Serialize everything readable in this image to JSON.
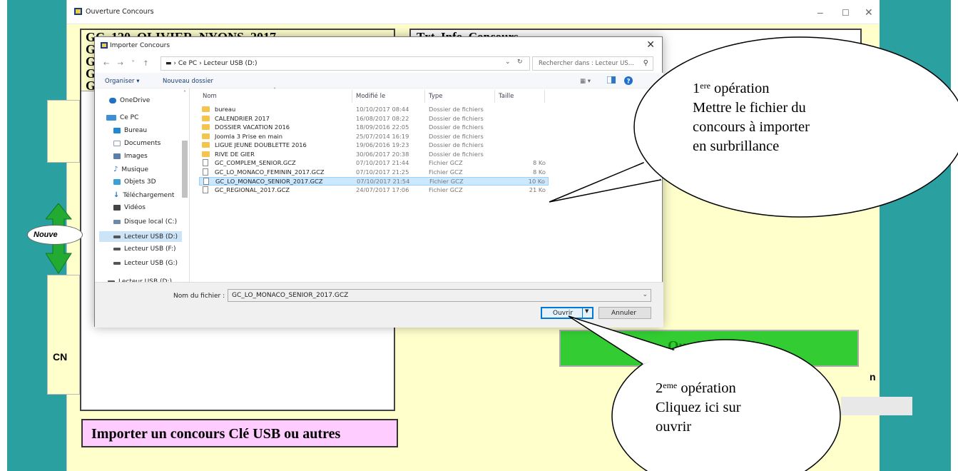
{
  "app_window": {
    "title": "Ouverture Concours",
    "header_text": "GC_120_OLIVIER_NYONS_2017",
    "header_partial_letters": [
      "G",
      "G",
      "G",
      "G"
    ],
    "right_header": "Txt_Info_Concours",
    "green_button_label": "Ouverture",
    "import_button_label": "Importer un concours Clé USB ou autres",
    "side_label_left": "CN",
    "side_label_right": "n",
    "nouveau_label": "Nouve"
  },
  "dialog": {
    "title": "Importer Concours",
    "breadcrumb": "▬  › Ce PC  ›  Lecteur USB (D:)",
    "search_placeholder": "Rechercher dans : Lecteur US...",
    "toolbar": {
      "organize": "Organiser ▾",
      "new_folder": "Nouveau dossier"
    },
    "nav_items": [
      {
        "label": "OneDrive",
        "icon": "cloud-icon",
        "color": "#1e70c8",
        "selected": false
      },
      {
        "label": "Ce PC",
        "icon": "computer-icon",
        "color": "#3d8fd6",
        "selected": false
      },
      {
        "label": "Bureau",
        "icon": "desktop-icon",
        "color": "#1e88d0",
        "selected": false
      },
      {
        "label": "Documents",
        "icon": "document-icon",
        "color": "#8aa0b8",
        "selected": false
      },
      {
        "label": "Images",
        "icon": "images-icon",
        "color": "#5a7fa8",
        "selected": false
      },
      {
        "label": "Musique",
        "icon": "music-icon",
        "color": "#2a6fb8",
        "selected": false
      },
      {
        "label": "Objets 3D",
        "icon": "cube-icon",
        "color": "#3aa0d8",
        "selected": false
      },
      {
        "label": "Téléchargement",
        "icon": "download-icon",
        "color": "#1f6fc0",
        "selected": false
      },
      {
        "label": "Vidéos",
        "icon": "video-icon",
        "color": "#444",
        "selected": false
      },
      {
        "label": "Disque local (C:)",
        "icon": "disk-icon",
        "color": "#6a8aa8",
        "selected": false
      },
      {
        "label": "Lecteur USB (D:)",
        "icon": "usb-drive-icon",
        "color": "#555",
        "selected": true
      },
      {
        "label": "Lecteur USB (F:)",
        "icon": "usb-drive-icon",
        "color": "#555",
        "selected": false
      },
      {
        "label": "Lecteur USB (G:)",
        "icon": "usb-drive-icon",
        "color": "#555",
        "selected": false
      },
      {
        "label": "Lecteur USB (D:)",
        "icon": "usb-drive-icon",
        "color": "#555",
        "selected": false
      }
    ],
    "columns": {
      "name": "Nom",
      "modified": "Modifié le",
      "type": "Type",
      "size": "Taille"
    },
    "files": [
      {
        "name": "bureau",
        "modified": "10/10/2017 08:44",
        "type": "Dossier de fichiers",
        "size": "",
        "kind": "folder",
        "selected": false
      },
      {
        "name": "CALENDRIER 2017",
        "modified": "16/08/2017 08:22",
        "type": "Dossier de fichiers",
        "size": "",
        "kind": "folder",
        "selected": false
      },
      {
        "name": "DOSSIER VACATION 2016",
        "modified": "18/09/2016 22:05",
        "type": "Dossier de fichiers",
        "size": "",
        "kind": "folder",
        "selected": false
      },
      {
        "name": "Joomla 3 Prise en main",
        "modified": "25/07/2014 16:19",
        "type": "Dossier de fichiers",
        "size": "",
        "kind": "folder",
        "selected": false
      },
      {
        "name": "LIGUE JEUNE DOUBLETTE 2016",
        "modified": "19/06/2016 19:23",
        "type": "Dossier de fichiers",
        "size": "",
        "kind": "folder",
        "selected": false
      },
      {
        "name": "RIVE DE GIER",
        "modified": "30/06/2017 20:38",
        "type": "Dossier de fichiers",
        "size": "",
        "kind": "folder",
        "selected": false
      },
      {
        "name": "GC_COMPLEM_SENIOR.GCZ",
        "modified": "07/10/2017 21:44",
        "type": "Fichier GCZ",
        "size": "8 Ko",
        "kind": "file",
        "selected": false
      },
      {
        "name": "GC_LO_MONACO_FEMININ_2017.GCZ",
        "modified": "07/10/2017 21:25",
        "type": "Fichier GCZ",
        "size": "8 Ko",
        "kind": "file",
        "selected": false
      },
      {
        "name": "GC_LO_MONACO_SENIOR_2017.GCZ",
        "modified": "07/10/2017 21:54",
        "type": "Fichier GCZ",
        "size": "10 Ko",
        "kind": "file",
        "selected": true
      },
      {
        "name": "GC_REGIONAL_2017.GCZ",
        "modified": "24/07/2017 17:06",
        "type": "Fichier GCZ",
        "size": "21 Ko",
        "kind": "file",
        "selected": false
      }
    ],
    "filename_label": "Nom du fichier :",
    "filename_value": "GC_LO_MONACO_SENIOR_2017.GCZ",
    "open_button": "Ouvrir",
    "cancel_button": "Annuler"
  },
  "callouts": {
    "first": {
      "ordinal": "1",
      "sup": "ere",
      "title": " opération",
      "lines": [
        "Mettre le fichier du",
        "concours à importer",
        "en surbrillance"
      ]
    },
    "second": {
      "ordinal": "2",
      "sup": "eme",
      "title": " opération",
      "lines": [
        "Cliquez ici sur",
        "ouvrir"
      ]
    }
  },
  "colors": {
    "teal": "#2aa0a0",
    "app_bg": "#ffffcc",
    "green_button": "#33cc33",
    "import_button": "#ffccff",
    "selection": "#cce8ff"
  }
}
